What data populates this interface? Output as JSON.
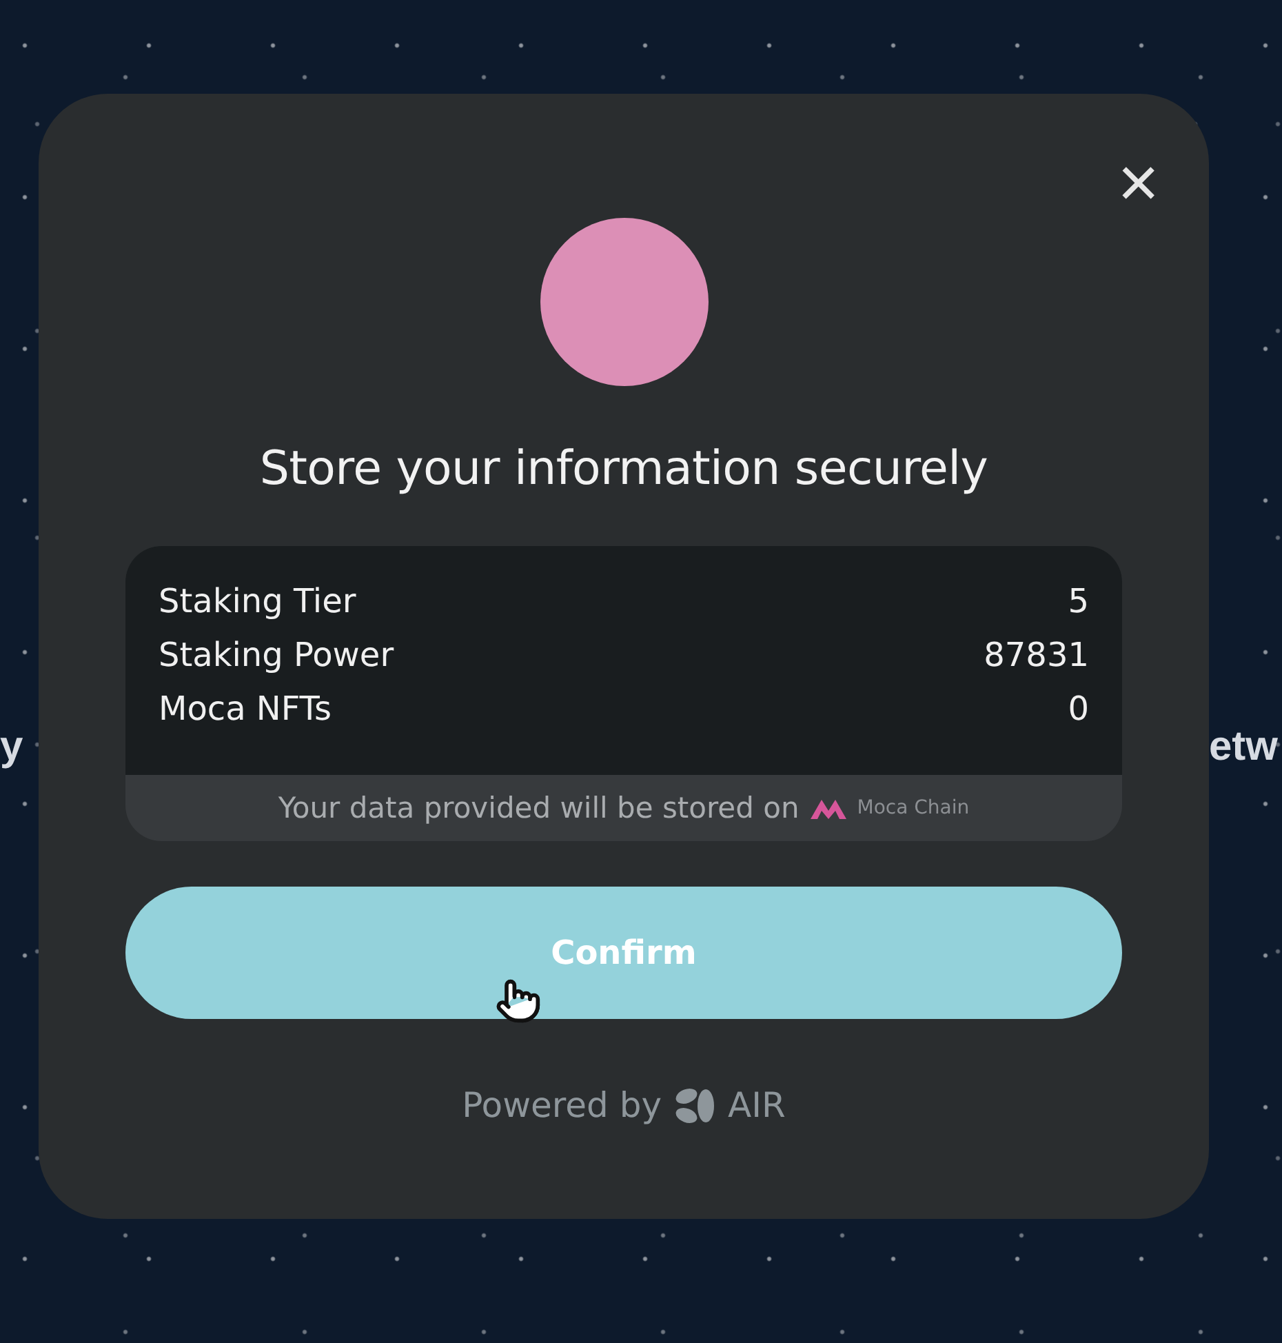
{
  "background_text": {
    "left": "y",
    "right": "etw"
  },
  "dialog": {
    "title": "Store your information securely",
    "close": "×",
    "rows": [
      {
        "label": "Staking Tier",
        "value": "5"
      },
      {
        "label": "Staking Power",
        "value": "87831"
      },
      {
        "label": "Moca NFTs",
        "value": "0"
      }
    ],
    "storage_note": "Your data provided will be stored on",
    "chain_name": "Moca Chain",
    "confirm": "Confirm",
    "powered_by": "Powered by",
    "brand": "AIR"
  }
}
